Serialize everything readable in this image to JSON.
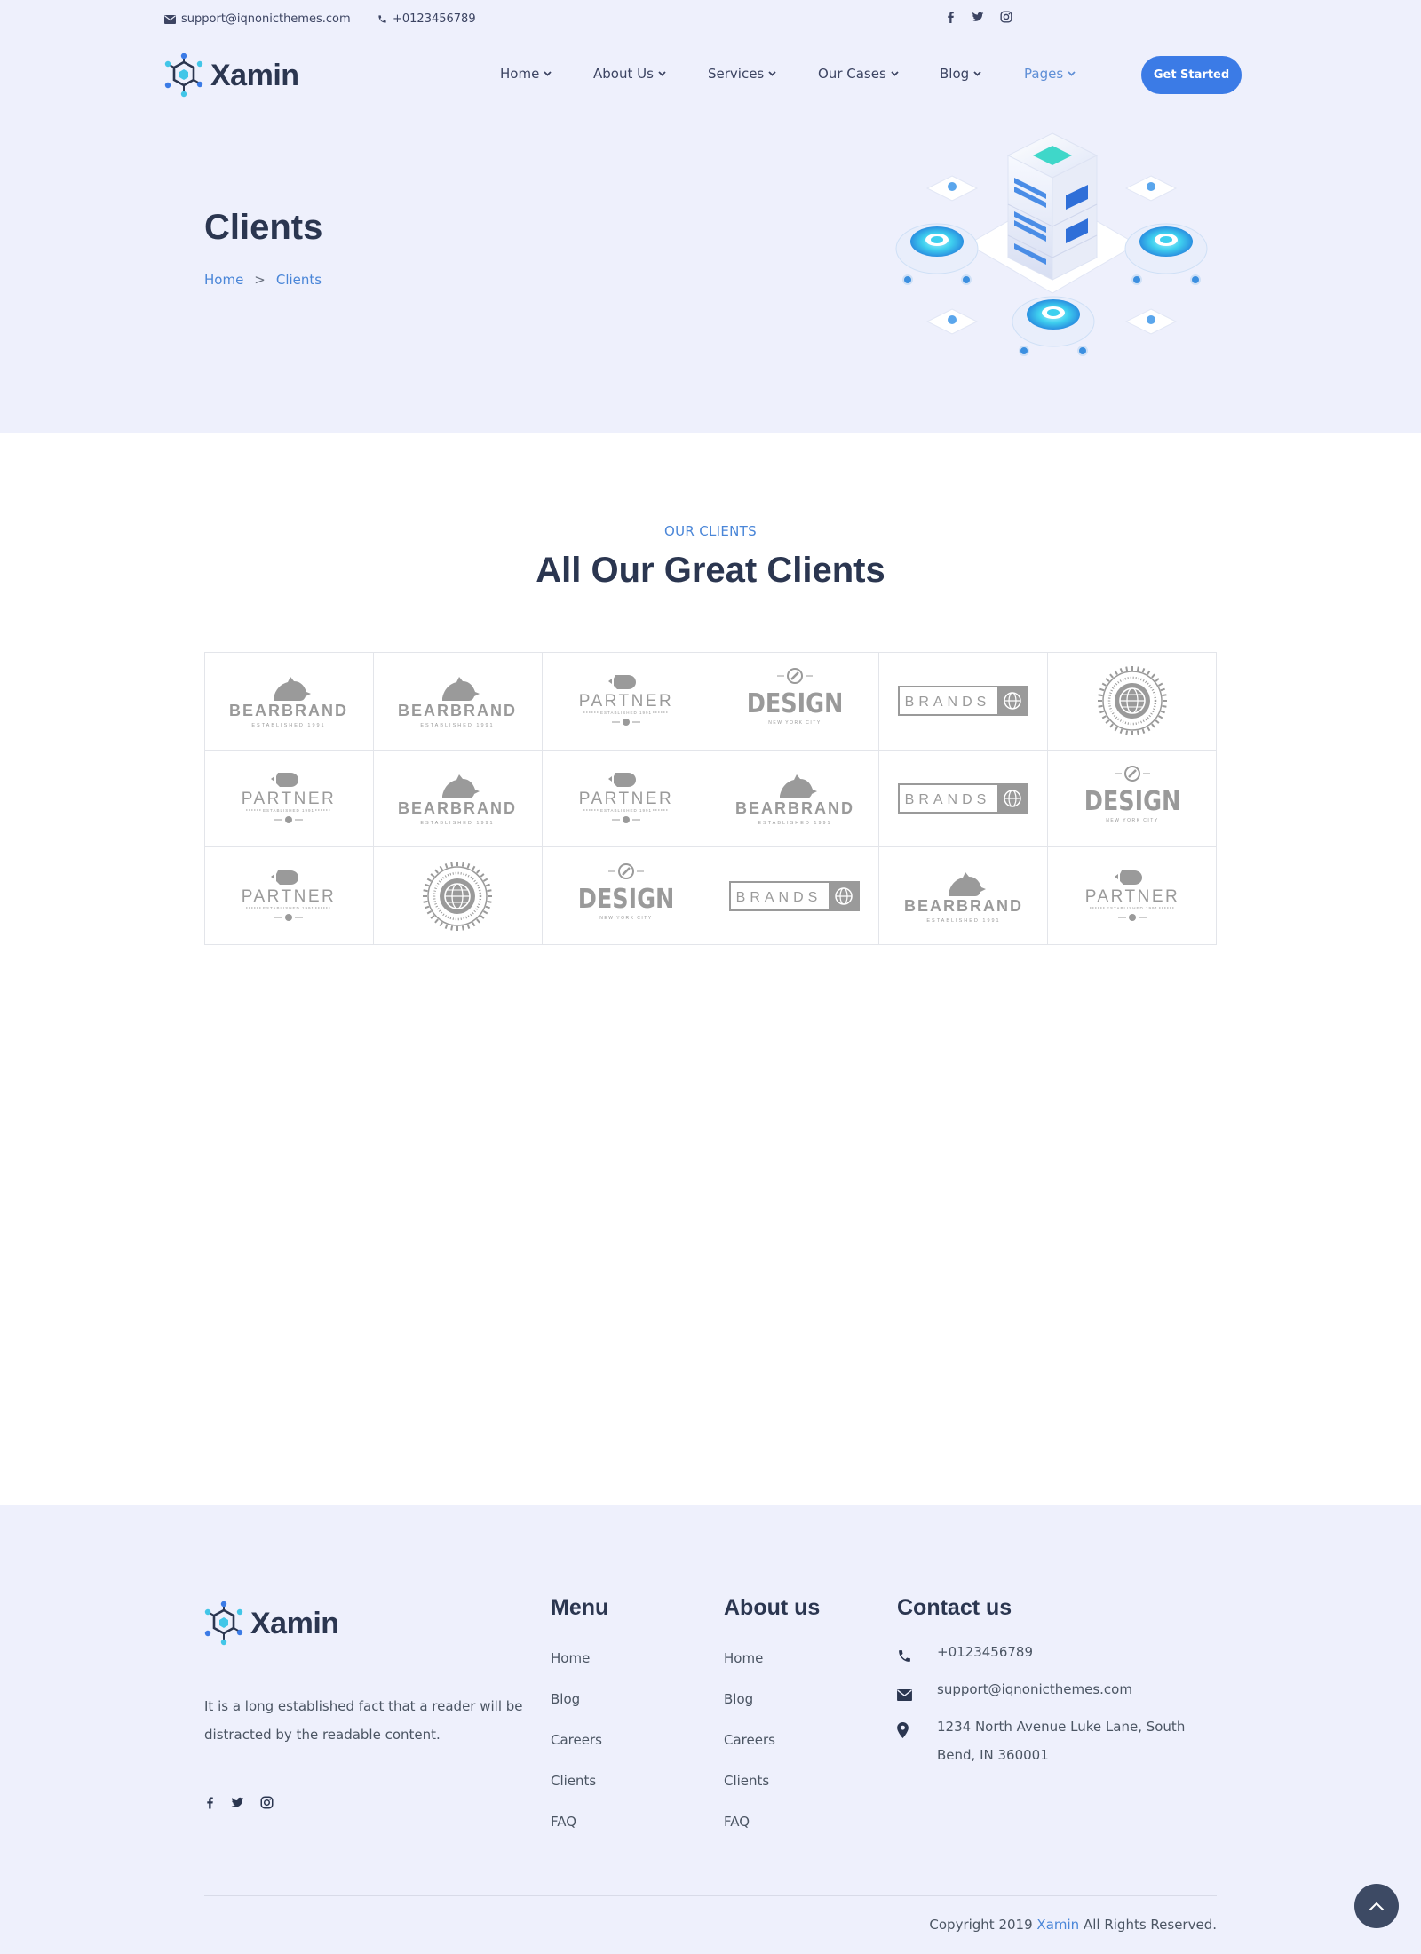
{
  "topbar": {
    "email": "support@iqnonicthemes.com",
    "phone": "+0123456789",
    "social": [
      "facebook-icon",
      "twitter-icon",
      "instagram-icon"
    ]
  },
  "brand": {
    "name": "Xamin"
  },
  "nav": {
    "items": [
      {
        "label": "Home",
        "active": false
      },
      {
        "label": "About Us",
        "active": false
      },
      {
        "label": "Services",
        "active": false
      },
      {
        "label": "Our Cases",
        "active": false
      },
      {
        "label": "Blog",
        "active": false
      },
      {
        "label": "Pages",
        "active": true
      }
    ],
    "cta": "Get Started"
  },
  "hero": {
    "title": "Clients",
    "breadcrumb": [
      "Home",
      "Clients"
    ],
    "breadcrumb_separator": ">",
    "illustration": "isometric-server-illustration"
  },
  "clients": {
    "subtitle": "OUR CLIENTS",
    "title": "All Our Great Clients",
    "logos": [
      {
        "type": "bearbrand",
        "text": "BEARBRAND",
        "tag": "ESTABLISHED 1991"
      },
      {
        "type": "bearbrand",
        "text": "BEARBRAND",
        "tag": "ESTABLISHED 1991"
      },
      {
        "type": "partner",
        "text": "PARTNER",
        "tag": "ESTABLISHED 1991"
      },
      {
        "type": "design",
        "text": "DESIGN",
        "tag": "NEW YORK CITY"
      },
      {
        "type": "brands",
        "text": "BRANDS",
        "tag": ""
      },
      {
        "type": "seal",
        "text": "",
        "tag": ""
      },
      {
        "type": "partner",
        "text": "PARTNER",
        "tag": "ESTABLISHED 1991"
      },
      {
        "type": "bearbrand",
        "text": "BEARBRAND",
        "tag": "ESTABLISHED 1991"
      },
      {
        "type": "partner",
        "text": "PARTNER",
        "tag": "ESTABLISHED 1991"
      },
      {
        "type": "bearbrand",
        "text": "BEARBRAND",
        "tag": "ESTABLISHED 1991"
      },
      {
        "type": "brands",
        "text": "BRANDS",
        "tag": ""
      },
      {
        "type": "design",
        "text": "DESIGN",
        "tag": "NEW YORK CITY"
      },
      {
        "type": "partner",
        "text": "PARTNER",
        "tag": "ESTABLISHED 1991"
      },
      {
        "type": "seal",
        "text": "",
        "tag": ""
      },
      {
        "type": "design",
        "text": "DESIGN",
        "tag": "NEW YORK CITY"
      },
      {
        "type": "brands",
        "text": "BRANDS",
        "tag": ""
      },
      {
        "type": "bearbrand",
        "text": "BEARBRAND",
        "tag": "ESTABLISHED 1991"
      },
      {
        "type": "partner",
        "text": "PARTNER",
        "tag": "ESTABLISHED 1991"
      }
    ]
  },
  "footer": {
    "about": "It is a long established fact that a reader will be distracted by the readable content.",
    "menu": {
      "heading": "Menu",
      "links": [
        "Home",
        "Blog",
        "Careers",
        "Clients",
        "FAQ"
      ]
    },
    "about_us": {
      "heading": "About us",
      "links": [
        "Home",
        "Blog",
        "Careers",
        "Clients",
        "FAQ"
      ]
    },
    "contact": {
      "heading": "Contact us",
      "phone": "+0123456789",
      "email": "support@iqnonicthemes.com",
      "address": "1234 North Avenue Luke Lane, South Bend, IN 360001"
    },
    "copyright_prefix": "Copyright 2019",
    "copyright_brand": "Xamin",
    "copyright_suffix": "All Rights Reserved."
  },
  "colors": {
    "accent": "#3b7be6",
    "link": "#4a86d8",
    "heading": "#2b3650",
    "band": "#eef0fc",
    "logo_gray": "#9a9a9a"
  }
}
